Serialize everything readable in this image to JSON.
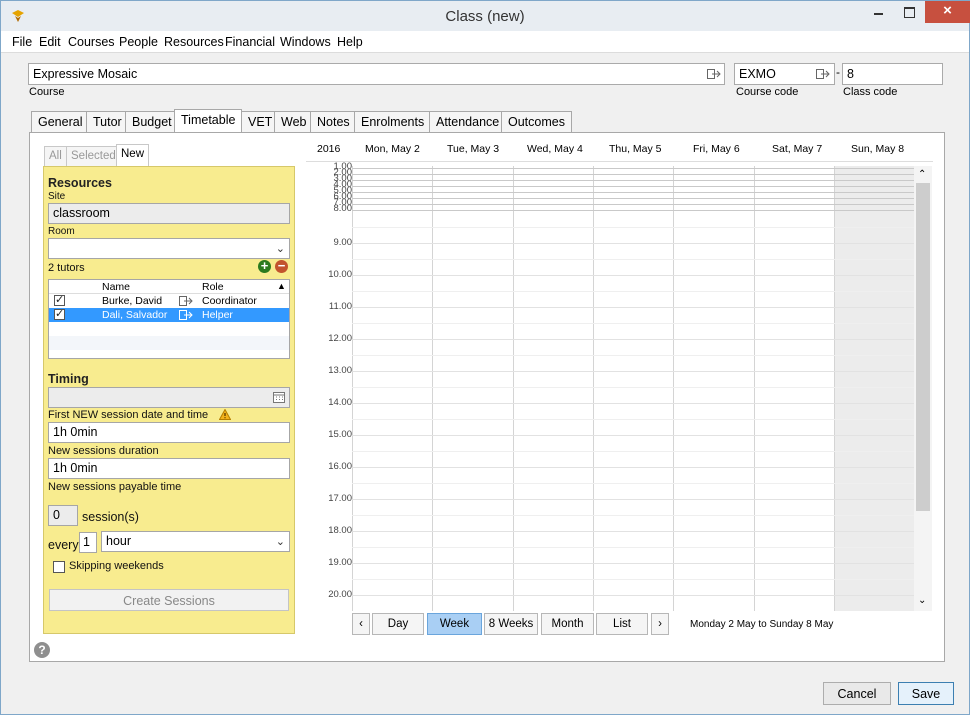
{
  "window": {
    "title": "Class (new)",
    "close_glyph": "×"
  },
  "menu": [
    "File",
    "Edit",
    "Courses",
    "People",
    "Resources",
    "Financial",
    "Windows",
    "Help"
  ],
  "course": {
    "value": "Expressive Mosaic",
    "label": "Course"
  },
  "course_code": {
    "value": "EXMO",
    "label": "Course code",
    "separator": "-"
  },
  "class_code": {
    "value": "8",
    "label": "Class code"
  },
  "tabs": [
    "General",
    "Tutor",
    "Budget",
    "Timetable",
    "VET",
    "Web",
    "Notes",
    "Enrolments",
    "Attendance",
    "Outcomes"
  ],
  "active_tab": "Timetable",
  "subtabs": [
    "All",
    "Selected",
    "New"
  ],
  "resources": {
    "heading": "Resources",
    "site_label": "Site",
    "site_value": "classroom",
    "room_label": "Room",
    "room_value": "",
    "tutors_count": "2 tutors",
    "table_headers": {
      "name": "Name",
      "role": "Role"
    },
    "tutors": [
      {
        "name": "Burke, David",
        "role": "Coordinator",
        "checked": true,
        "selected": false
      },
      {
        "name": "Dali, Salvador",
        "role": "Helper",
        "checked": true,
        "selected": true
      }
    ]
  },
  "timing": {
    "heading": "Timing",
    "first_session_value": "",
    "first_session_label": "First NEW session date and time",
    "duration_value": "1h 0min",
    "duration_label": "New sessions duration",
    "payable_value": "1h 0min",
    "payable_label": "New sessions payable time",
    "sessions_count": "0",
    "sessions_label": "session(s)",
    "every_label": "every",
    "every_value": "1",
    "every_unit": "hour",
    "skip_weekends_label": "Skipping weekends",
    "skip_weekends_checked": false,
    "create_button": "Create Sessions"
  },
  "calendar": {
    "year": "2016",
    "days": [
      "Mon, May 2",
      "Tue, May 3",
      "Wed, May 4",
      "Thu, May 5",
      "Fri, May 6",
      "Sat, May 7",
      "Sun, May 8"
    ],
    "early_hours": [
      "1.00",
      "2.00",
      "3.00",
      "4.00",
      "5.00",
      "6.00",
      "7.00",
      "8.00"
    ],
    "hours": [
      "9.00",
      "10.00",
      "11.00",
      "12.00",
      "13.00",
      "14.00",
      "15.00",
      "16.00",
      "17.00",
      "18.00",
      "19.00",
      "20.00"
    ],
    "views": [
      "Day",
      "Week",
      "8 Weeks",
      "Month",
      "List"
    ],
    "active_view": "Week",
    "range": "Monday 2 May to Sunday 8 May",
    "prev_glyph": "‹",
    "next_glyph": "›"
  },
  "footer": {
    "cancel": "Cancel",
    "save": "Save",
    "help_glyph": "?"
  },
  "colors": {
    "panel": "#f8ec8f",
    "selection": "#3399ff",
    "active_view": "#a9cff4"
  }
}
